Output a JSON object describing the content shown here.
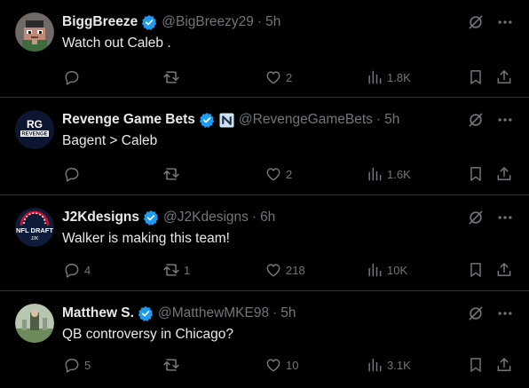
{
  "colors": {
    "background": "#000000",
    "text": "#e7e9ea",
    "secondary": "#71767b",
    "divider": "#2f3336",
    "verified": "#1d9bf0"
  },
  "tweets": [
    {
      "name": "BiggBreeze",
      "handle": "@BigBreezy29",
      "dot": "·",
      "time": "5h",
      "text": "Watch out Caleb .",
      "replies": "",
      "retweets": "",
      "likes": "2",
      "views": "1.8K",
      "avatar_icon": "pixel-art-avatar-icon",
      "affiliate_badge": false
    },
    {
      "name": "Revenge Game Bets",
      "handle": "@RevengeGameBets",
      "dot": "·",
      "time": "5h",
      "text": "Bagent > Caleb",
      "replies": "",
      "retweets": "",
      "likes": "2",
      "views": "1.6K",
      "avatar_icon": "revenge-logo-avatar-icon",
      "affiliate_badge": true
    },
    {
      "name": "J2Kdesigns",
      "handle": "@J2Kdesigns",
      "dot": "·",
      "time": "6h",
      "text": "Walker is making this team!",
      "replies": "4",
      "retweets": "1",
      "likes": "218",
      "views": "10K",
      "avatar_icon": "nfl-draft-avatar-icon",
      "affiliate_badge": false
    },
    {
      "name": "Matthew S.",
      "handle": "@MatthewMKE98",
      "dot": "·",
      "time": "5h",
      "text": "QB controversy in Chicago?",
      "replies": "5",
      "retweets": "",
      "likes": "10",
      "views": "3.1K",
      "avatar_icon": "photo-avatar-icon",
      "affiliate_badge": false
    }
  ],
  "avatar_text": {
    "revenge_top": "RG",
    "revenge_word": "REVENGE",
    "nfl_line1": "NFL DRAFT",
    "nfl_line2": "J2K"
  }
}
